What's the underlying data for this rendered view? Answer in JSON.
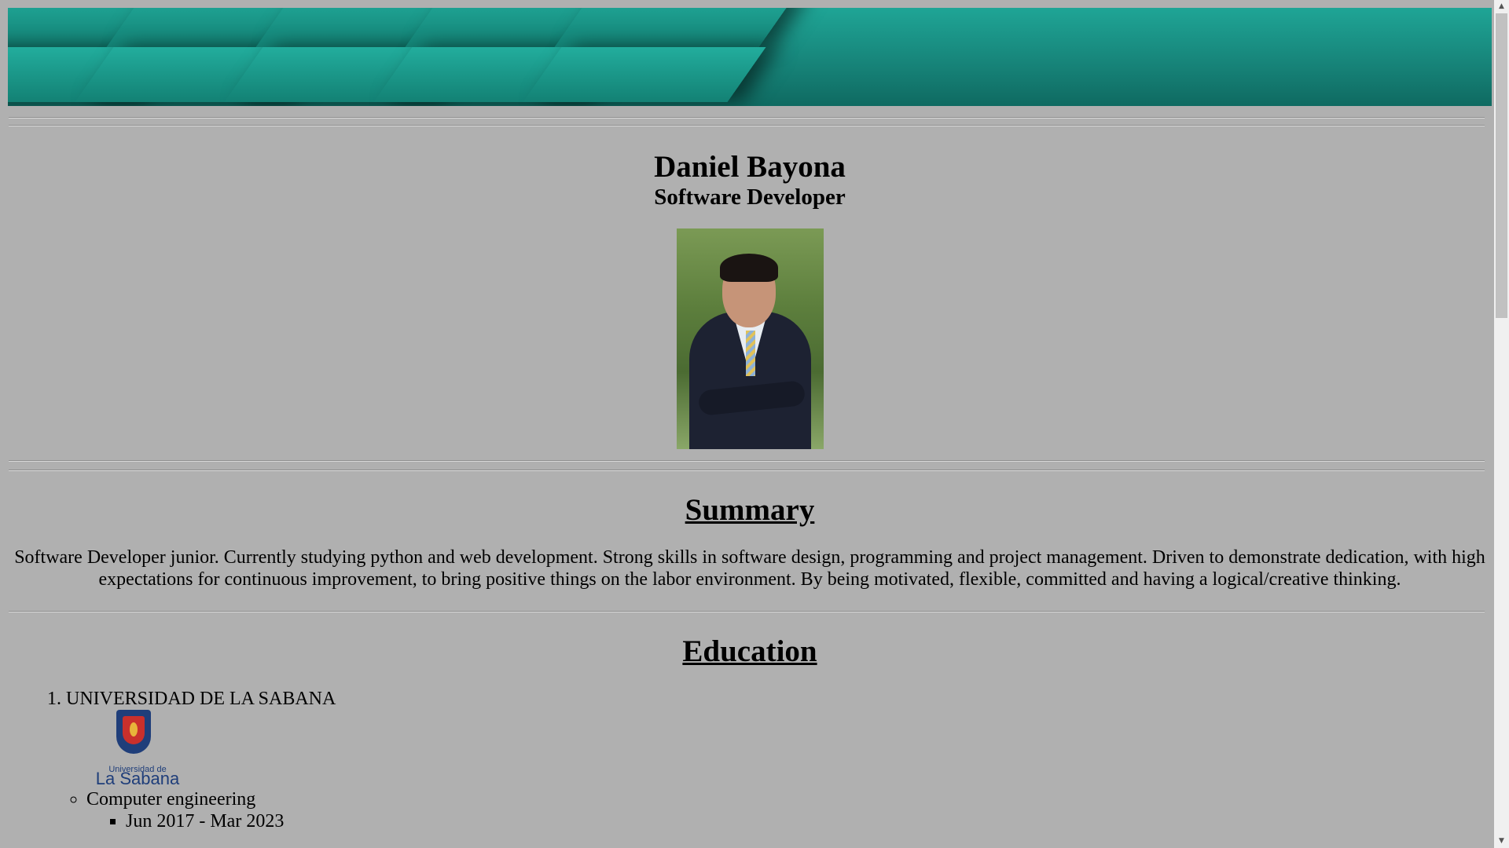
{
  "profile": {
    "name": "Daniel Bayona",
    "title": "Software Developer"
  },
  "summary": {
    "heading": "Summary",
    "text": "Software Developer junior. Currently studying python and web development. Strong skills in software design, programming and project management. Driven to demonstrate dedication, with high expectations for continuous improvement, to bring positive things on the labor environment. By being motivated, flexible, committed and having a logical/creative thinking."
  },
  "education": {
    "heading": "Education",
    "items": [
      {
        "number": "1.",
        "school": "UNIVERSIDAD DE LA SABANA",
        "logo_small": "Universidad de",
        "logo_big": "La Sabana",
        "degree": "Computer engineering",
        "dates": "Jun 2017 - Mar 2023"
      }
    ]
  },
  "scrollbar": {
    "up_icon": "▲",
    "down_icon": "▼"
  }
}
